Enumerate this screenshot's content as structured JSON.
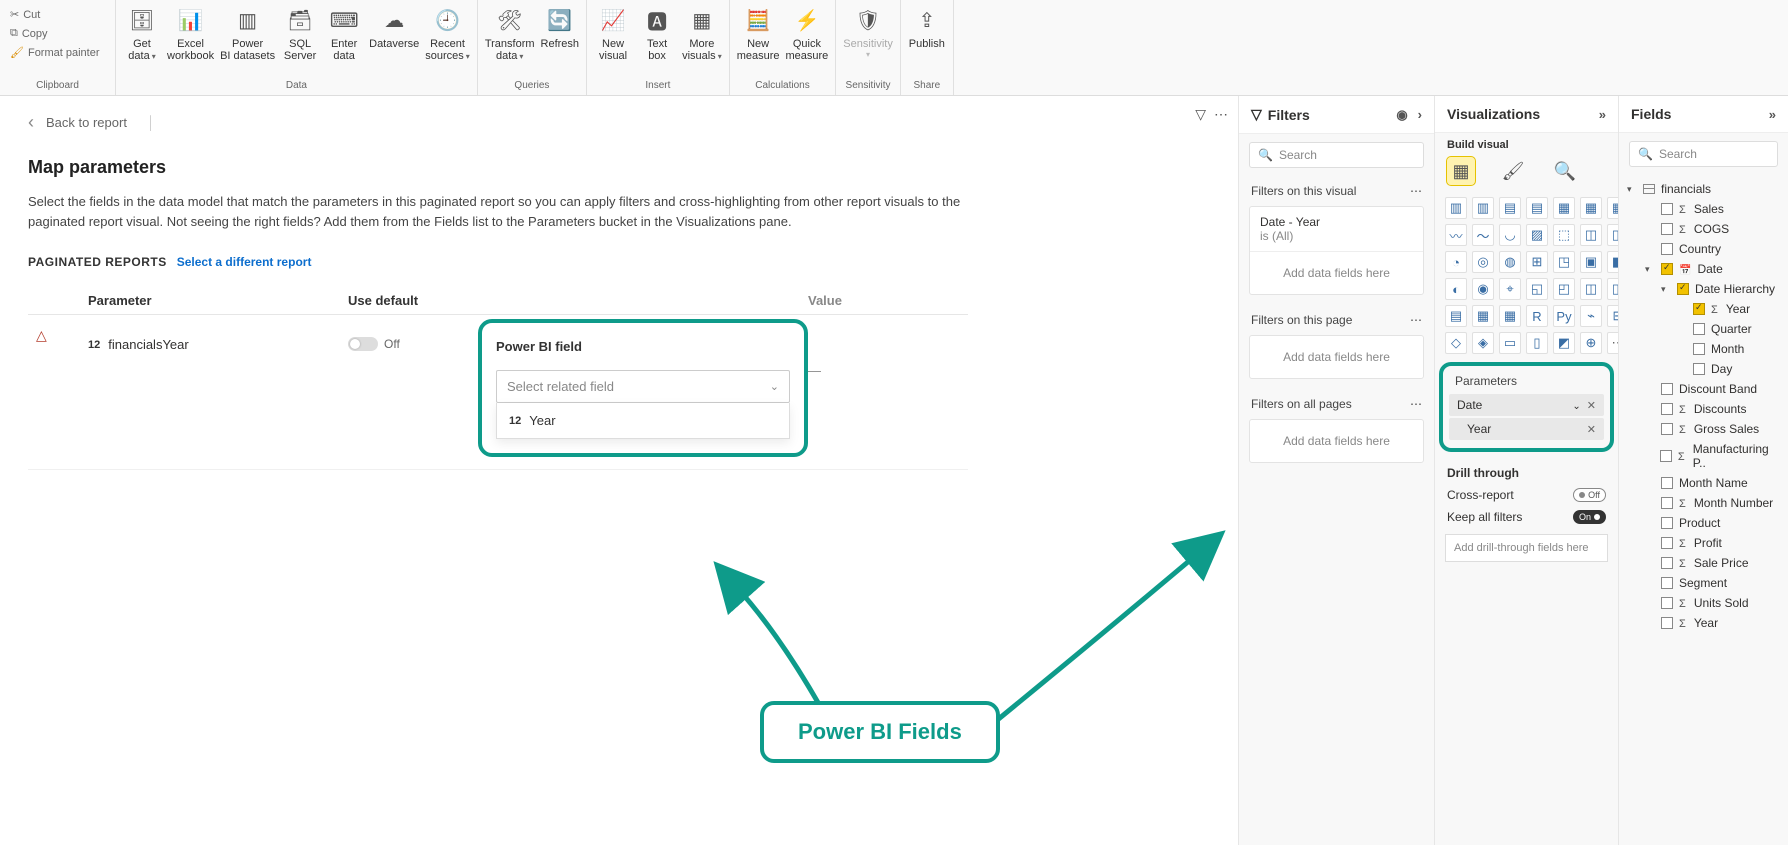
{
  "ribbon": {
    "clipboard": {
      "cut": "Cut",
      "copy": "Copy",
      "painter": "Format painter",
      "group": "Clipboard"
    },
    "data": {
      "group": "Data",
      "buttons": [
        {
          "label": "Get data",
          "drop": true
        },
        {
          "label": "Excel workbook"
        },
        {
          "label": "Power BI datasets"
        },
        {
          "label": "SQL Server"
        },
        {
          "label": "Enter data"
        },
        {
          "label": "Dataverse"
        },
        {
          "label": "Recent sources",
          "drop": true
        }
      ]
    },
    "queries": {
      "group": "Queries",
      "buttons": [
        {
          "label": "Transform data",
          "drop": true
        },
        {
          "label": "Refresh"
        }
      ]
    },
    "insert": {
      "group": "Insert",
      "buttons": [
        {
          "label": "New visual"
        },
        {
          "label": "Text box"
        },
        {
          "label": "More visuals",
          "drop": true
        }
      ]
    },
    "calc": {
      "group": "Calculations",
      "buttons": [
        {
          "label": "New measure"
        },
        {
          "label": "Quick measure"
        }
      ]
    },
    "sensitivity": {
      "group": "Sensitivity",
      "label": "Sensitivity"
    },
    "share": {
      "group": "Share",
      "label": "Publish"
    }
  },
  "canvas": {
    "back": "Back to report",
    "title": "Map parameters",
    "desc": "Select the fields in the data model that match the parameters in this paginated report so you can apply filters and cross-highlighting from other report visuals to the paginated report visual. Not seeing the right fields? Add them from the Fields list to the Parameters bucket in the Visualizations pane.",
    "pag_label": "PAGINATED REPORTS",
    "select_link": "Select a different report",
    "columns": {
      "param": "Parameter",
      "def": "Use default",
      "field": "Power BI field",
      "value": "Value"
    },
    "row": {
      "icon12": "12",
      "param": "financialsYear",
      "off": "Off",
      "placeholder": "Select related field",
      "dash": "—"
    },
    "dd_option": {
      "icon12": "12",
      "label": "Year"
    },
    "annotation": "Power BI Fields"
  },
  "filters": {
    "title": "Filters",
    "search": "Search",
    "sections": {
      "visual": "Filters on this visual",
      "page": "Filters on this page",
      "all": "Filters on all pages"
    },
    "visual_item": {
      "line1": "Date - Year",
      "line2": "is (All)"
    },
    "placeholder": "Add data fields here"
  },
  "viz": {
    "title": "Visualizations",
    "sub": "Build visual",
    "params_hd": "Parameters",
    "params": {
      "root": "Date",
      "child": "Year"
    },
    "drill_hd": "Drill through",
    "cross": "Cross-report",
    "keep": "Keep all filters",
    "off": "Off",
    "on": "On",
    "drill_placeholder": "Add drill-through fields here"
  },
  "fields": {
    "title": "Fields",
    "search": "Search",
    "table": "financials",
    "items_top": [
      "Sales",
      "COGS",
      "Country"
    ],
    "date": "Date",
    "hierarchy": "Date Hierarchy",
    "levels": [
      "Year",
      "Quarter",
      "Month",
      "Day"
    ],
    "items_bottom": [
      {
        "label": "Discount Band",
        "sigma": false
      },
      {
        "label": "Discounts",
        "sigma": true
      },
      {
        "label": "Gross Sales",
        "sigma": true
      },
      {
        "label": "Manufacturing P..",
        "sigma": true
      },
      {
        "label": "Month Name",
        "sigma": false
      },
      {
        "label": "Month Number",
        "sigma": true
      },
      {
        "label": "Product",
        "sigma": false
      },
      {
        "label": "Profit",
        "sigma": true
      },
      {
        "label": "Sale Price",
        "sigma": true
      },
      {
        "label": "Segment",
        "sigma": false
      },
      {
        "label": "Units Sold",
        "sigma": true
      },
      {
        "label": "Year",
        "sigma": true
      }
    ]
  }
}
